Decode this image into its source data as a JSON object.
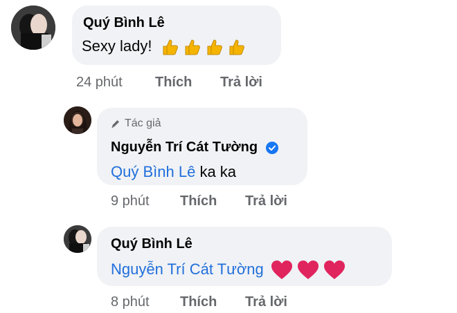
{
  "comments": [
    {
      "author": "Quý Bình Lê",
      "text": "Sexy lady!",
      "reaction_icons": [
        "thumbs-up-icon",
        "thumbs-up-icon",
        "thumbs-up-icon",
        "thumbs-up-icon"
      ],
      "time": "24 phút",
      "like_label": "Thích",
      "reply_label": "Trả lời"
    },
    {
      "badge_icon": "pencil-icon",
      "badge": "Tác giả",
      "author": "Nguyễn Trí Cát Tường",
      "verified_icon": "verified-check-icon",
      "mention": "Quý Bình Lê",
      "text": "ka ka",
      "time": "9 phút",
      "like_label": "Thích",
      "reply_label": "Trả lời"
    },
    {
      "author": "Quý Bình Lê",
      "mention": "Nguyễn Trí Cát Tường",
      "reaction_icons": [
        "red-heart-icon",
        "red-heart-icon",
        "red-heart-icon"
      ],
      "time": "8 phút",
      "like_label": "Thích",
      "reply_label": "Trả lời"
    }
  ],
  "colors": {
    "bubble": "#f0f2f5",
    "mention": "#216fdb",
    "muted": "#65676b",
    "verified": "#1877f2",
    "heart": "#e0245e",
    "thumbs": "#f5b400"
  }
}
